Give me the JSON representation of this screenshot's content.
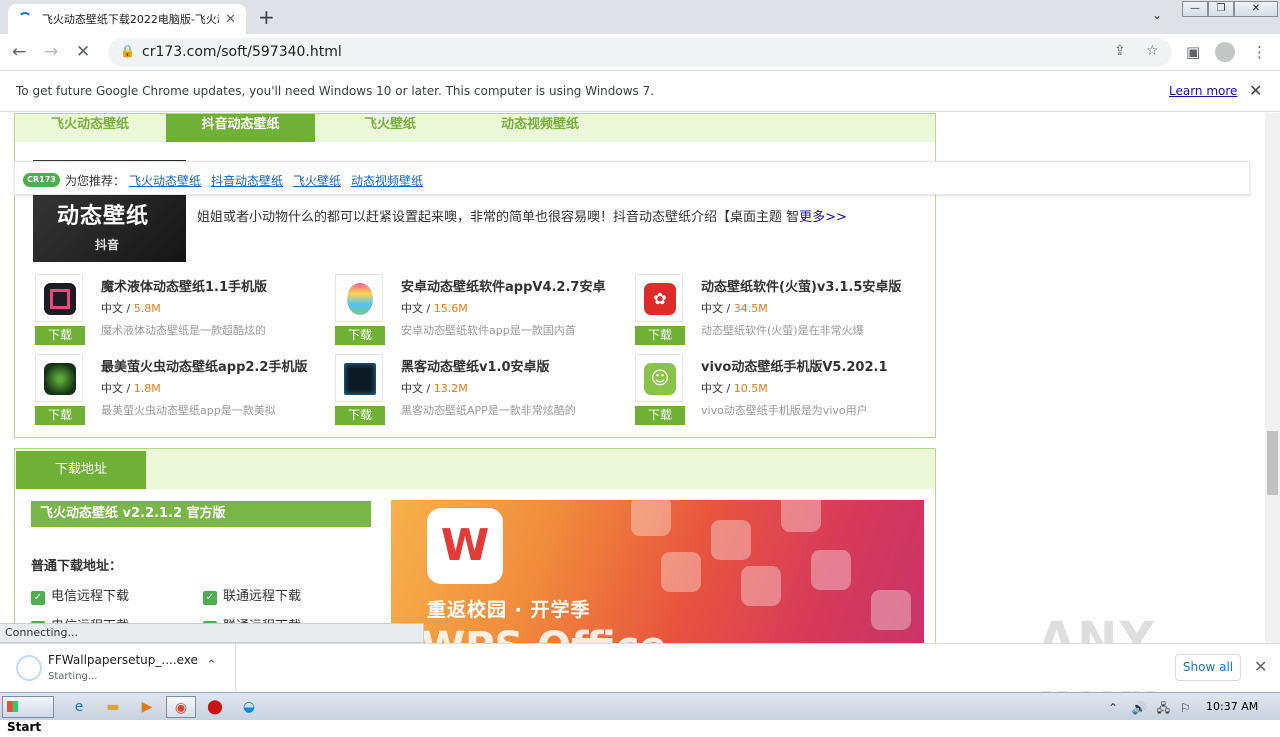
{
  "browser": {
    "tab_title": "飞火动态壁纸下载2022电脑版-飞火动态壁纸",
    "url": "cr173.com/soft/597340.html",
    "infobar_text": "To get future Google Chrome updates, you'll need Windows 10 or later. This computer is using Windows 7.",
    "learn_more": "Learn more"
  },
  "page": {
    "subtabs": [
      "飞火动态壁纸",
      "抖音动态壁纸",
      "飞火壁纸",
      "动态视频壁纸"
    ],
    "active_subtab": 1,
    "rec": {
      "logo": "CR173",
      "label": "为您推荐：",
      "links": [
        "飞火动态壁纸",
        "抖音动态壁纸",
        "飞火壁纸",
        "动态视频壁纸"
      ]
    },
    "feature": {
      "thumb_title": "动态壁纸",
      "thumb_sub": "抖音",
      "desc": "姐姐或者小动物什么的都可以赶紧设置起来噢，非常的简单也很容易噢！抖音动态壁纸介绍【桌面主题 智",
      "more": "更多>>"
    },
    "apps": [
      {
        "name": "魔术液体动态壁纸1.1手机版",
        "lang": "中文 / ",
        "size": "5.8M",
        "desc": "魔术液体动态壁纸是一款超酷炫的",
        "dl": "下载",
        "icon_color": "#1c1c24"
      },
      {
        "name": "安卓动态壁纸软件appV4.2.7安卓",
        "lang": "中文 / ",
        "size": "15.6M",
        "desc": "安卓动态壁纸软件app是一款国内首",
        "dl": "下载",
        "icon_color": "#f3c33a"
      },
      {
        "name": "动态壁纸软件(火萤)v3.1.5安卓版",
        "lang": "中文 / ",
        "size": "34.5M",
        "desc": "动态壁纸软件(火萤)是在非常火爆",
        "dl": "下载",
        "icon_color": "#e02b2b"
      },
      {
        "name": "最美萤火虫动态壁纸app2.2手机版",
        "lang": "中文 / ",
        "size": "1.8M",
        "desc": "最美萤火虫动态壁纸app是一款美拟",
        "dl": "下载",
        "icon_color": "#143314"
      },
      {
        "name": "黑客动态壁纸v1.0安卓版",
        "lang": "中文 / ",
        "size": "13.2M",
        "desc": "黑客动态壁纸APP是一款非常炫酷的",
        "dl": "下载",
        "icon_color": "#0d1a24"
      },
      {
        "name": "vivo动态壁纸手机版V5.202.1",
        "lang": "中文 / ",
        "size": "10.5M",
        "desc": "vivo动态壁纸手机版是为vivo用户",
        "dl": "下载",
        "icon_color": "#8bc34a"
      }
    ],
    "download": {
      "header": "下载地址",
      "version": "飞火动态壁纸 v2.2.1.2 官方版",
      "normal_label": "普通下载地址：",
      "links": [
        "电信远程下载",
        "联通远程下载",
        "电信远程下载",
        "联通远程下载"
      ]
    },
    "ad": {
      "slogan": "重返校园 · 开学季",
      "big_text": "WPS Office",
      "logo_letter": "W"
    }
  },
  "status": "Connecting...",
  "shelf": {
    "file": "FFWallpapersetup_....exe",
    "state": "Starting...",
    "show_all": "Show all"
  },
  "watermark": "ANY RUN",
  "taskbar": {
    "start": "Start",
    "clock": "10:37 AM"
  }
}
